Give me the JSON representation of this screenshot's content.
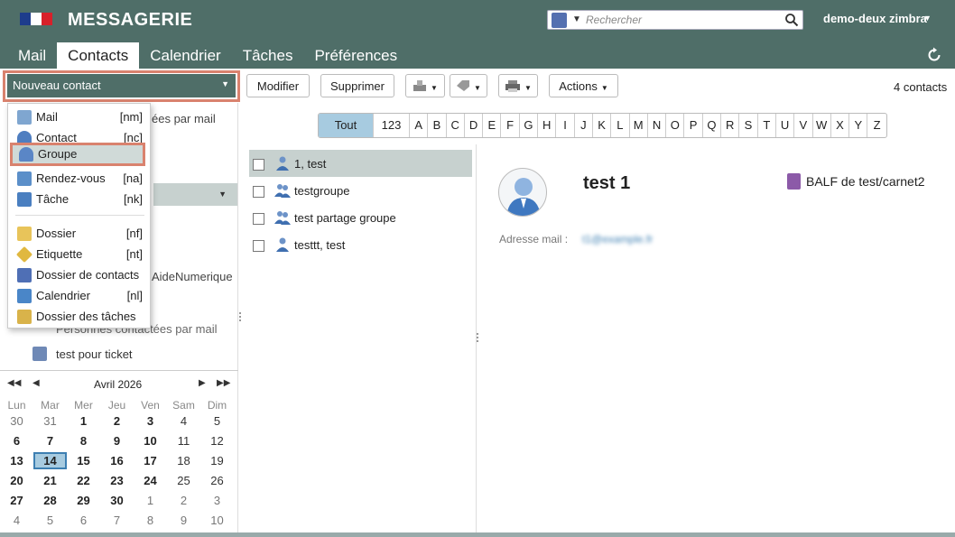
{
  "header": {
    "brand": "MESSAGERIE",
    "flag_colors": [
      "#1e3c8c",
      "#ffffff",
      "#d8202a"
    ],
    "search_placeholder": "Rechercher",
    "user": "demo-deux zimbra"
  },
  "tabs": [
    {
      "label": "Mail",
      "active": false
    },
    {
      "label": "Contacts",
      "active": true
    },
    {
      "label": "Calendrier",
      "active": false
    },
    {
      "label": "Tâches",
      "active": false
    },
    {
      "label": "Préférences",
      "active": false
    }
  ],
  "toolbar": {
    "new_label": "Nouveau contact",
    "edit_label": "Modifier",
    "delete_label": "Supprimer",
    "actions_label": "Actions",
    "count": "4 contacts"
  },
  "menu": {
    "items": [
      {
        "label": "Mail",
        "shortcut": "[nm]",
        "icon": "mail-icon"
      },
      {
        "label": "Contact",
        "shortcut": "[nc]",
        "icon": "contact-icon"
      },
      {
        "label": "Groupe",
        "shortcut": "",
        "icon": "group-icon",
        "highlighted": true
      },
      {
        "label": "Rendez-vous",
        "shortcut": "[na]",
        "icon": "appointment-icon"
      },
      {
        "label": "Tâche",
        "shortcut": "[nk]",
        "icon": "task-icon"
      },
      {
        "label": "Dossier",
        "shortcut": "[nf]",
        "icon": "folder-icon"
      },
      {
        "label": "Etiquette",
        "shortcut": "[nt]",
        "icon": "tag-icon"
      },
      {
        "label": "Dossier de contacts",
        "shortcut": "",
        "icon": "contacts-folder-icon"
      },
      {
        "label": "Calendrier",
        "shortcut": "[nl]",
        "icon": "calendar-icon"
      },
      {
        "label": "Dossier des tâches",
        "shortcut": "",
        "icon": "tasks-folder-icon"
      }
    ]
  },
  "left_behind": {
    "t1": "ées par mail",
    "t2": "AideNumerique",
    "t3": "Personnes contactées par mail",
    "ticket": "test pour ticket"
  },
  "calendar": {
    "title": "Avril 2026",
    "dow": [
      "Lun",
      "Mar",
      "Mer",
      "Jeu",
      "Ven",
      "Sam",
      "Dim"
    ],
    "weeks": [
      [
        "30",
        "31",
        "1",
        "2",
        "3",
        "4",
        "5"
      ],
      [
        "6",
        "7",
        "8",
        "9",
        "10",
        "11",
        "12"
      ],
      [
        "13",
        "14",
        "15",
        "16",
        "17",
        "18",
        "19"
      ],
      [
        "20",
        "21",
        "22",
        "23",
        "24",
        "25",
        "26"
      ],
      [
        "27",
        "28",
        "29",
        "30",
        "1",
        "2",
        "3"
      ],
      [
        "4",
        "5",
        "6",
        "7",
        "8",
        "9",
        "10"
      ]
    ],
    "today": "14"
  },
  "alphabet": [
    "Tout",
    "123",
    "A",
    "B",
    "C",
    "D",
    "E",
    "F",
    "G",
    "H",
    "I",
    "J",
    "K",
    "L",
    "M",
    "N",
    "O",
    "P",
    "Q",
    "R",
    "S",
    "T",
    "U",
    "V",
    "W",
    "X",
    "Y",
    "Z"
  ],
  "contacts": [
    {
      "name": "1, test",
      "type": "contact",
      "selected": true
    },
    {
      "name": "testgroupe",
      "type": "group",
      "selected": false
    },
    {
      "name": "test partage groupe",
      "type": "group",
      "selected": false
    },
    {
      "name": "testtt, test",
      "type": "contact",
      "selected": false
    }
  ],
  "detail": {
    "name": "test 1",
    "addressbook": "BALF de test/carnet2",
    "email_label": "Adresse mail :",
    "email_value": "t1@example.fr"
  },
  "colors": {
    "header": "#4f6e68",
    "highlight_border": "#d9826e",
    "selected": "#c7d1cf",
    "accent": "#a7cbe0"
  }
}
